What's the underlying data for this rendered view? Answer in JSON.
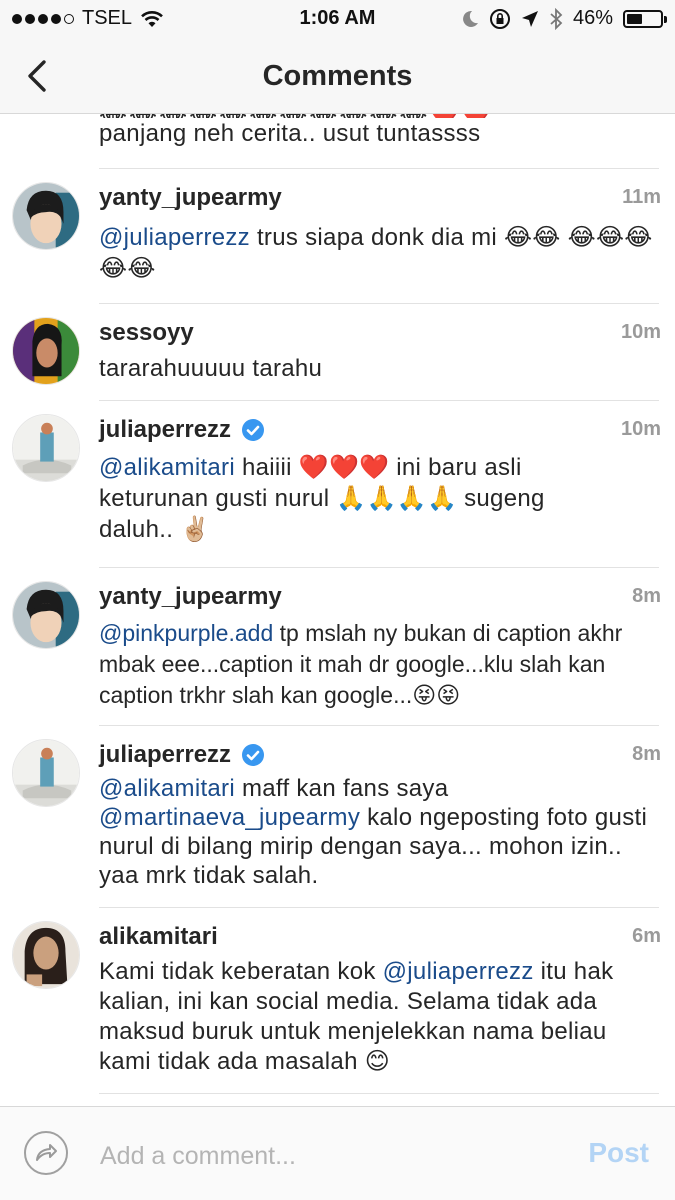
{
  "status": {
    "carrier": "TSEL",
    "time": "1:06 AM",
    "battery": "46%",
    "battery_level": 0.46
  },
  "nav": {
    "title": "Comments"
  },
  "partial_comment": {
    "emojis": "😂😂😂😂😂😂😂😂😂😂😂❤️❤️",
    "text": "panjang neh cerita.. usut tuntassss"
  },
  "comments": [
    {
      "user": "yanty_jupearmy",
      "time": "11m",
      "verified": false,
      "mention": "@juliaperrezz",
      "text": " trus siapa donk dia mi 😂😂 😂😂😂😂😂"
    },
    {
      "user": "sessoyy",
      "time": "10m",
      "verified": false,
      "mention": "",
      "text": "tararahuuuuu tarahu"
    },
    {
      "user": "juliaperrezz",
      "time": "10m",
      "verified": true,
      "mention": "@alikamitari",
      "text": " haiiii ❤️❤️❤️  ini baru asli keturunan gusti nurul 🙏🙏🙏🙏  sugeng daluh.. ✌🏼"
    },
    {
      "user": "yanty_jupearmy",
      "time": "8m",
      "verified": false,
      "mention": "@pinkpurple.add",
      "text": " tp mslah ny bukan di caption akhr mbak eee...caption it mah dr google...klu slah kan caption trkhr slah kan google...😝😝"
    },
    {
      "user": "juliaperrezz",
      "time": "8m",
      "verified": true,
      "mention": "@alikamitari",
      "text": " maff kan fans saya",
      "mention2": "@martinaeva_jupearmy",
      "text2": " kalo ngeposting foto gusti nurul di bilang mirip dengan saya... mohon izin.. yaa mrk tidak salah."
    },
    {
      "user": "alikamitari",
      "time": "6m",
      "verified": false,
      "pre_text": "Kami tidak keberatan kok ",
      "mention": "@juliaperrezz",
      "text": " itu hak kalian, ini kan social media. Selama tidak ada maksud buruk untuk menjelekkan nama beliau kami tidak ada masalah 😊"
    }
  ],
  "composer": {
    "placeholder": "Add a comment...",
    "value": "",
    "post_label": "Post"
  },
  "icons": {
    "signal": "signal-dots-icon",
    "wifi": "wifi-icon",
    "moon": "moon-icon",
    "rotation_lock": "rotation-lock-icon",
    "location": "location-arrow-icon",
    "bluetooth": "bluetooth-icon",
    "battery": "battery-icon",
    "back": "chevron-left-icon",
    "verified": "verified-badge-icon",
    "share": "share-arrow-icon"
  },
  "colors": {
    "mention": "#1a4b8a",
    "verified": "#3897f0",
    "post_disabled": "#b3d4f5",
    "timestamp": "#9a9a9a"
  }
}
